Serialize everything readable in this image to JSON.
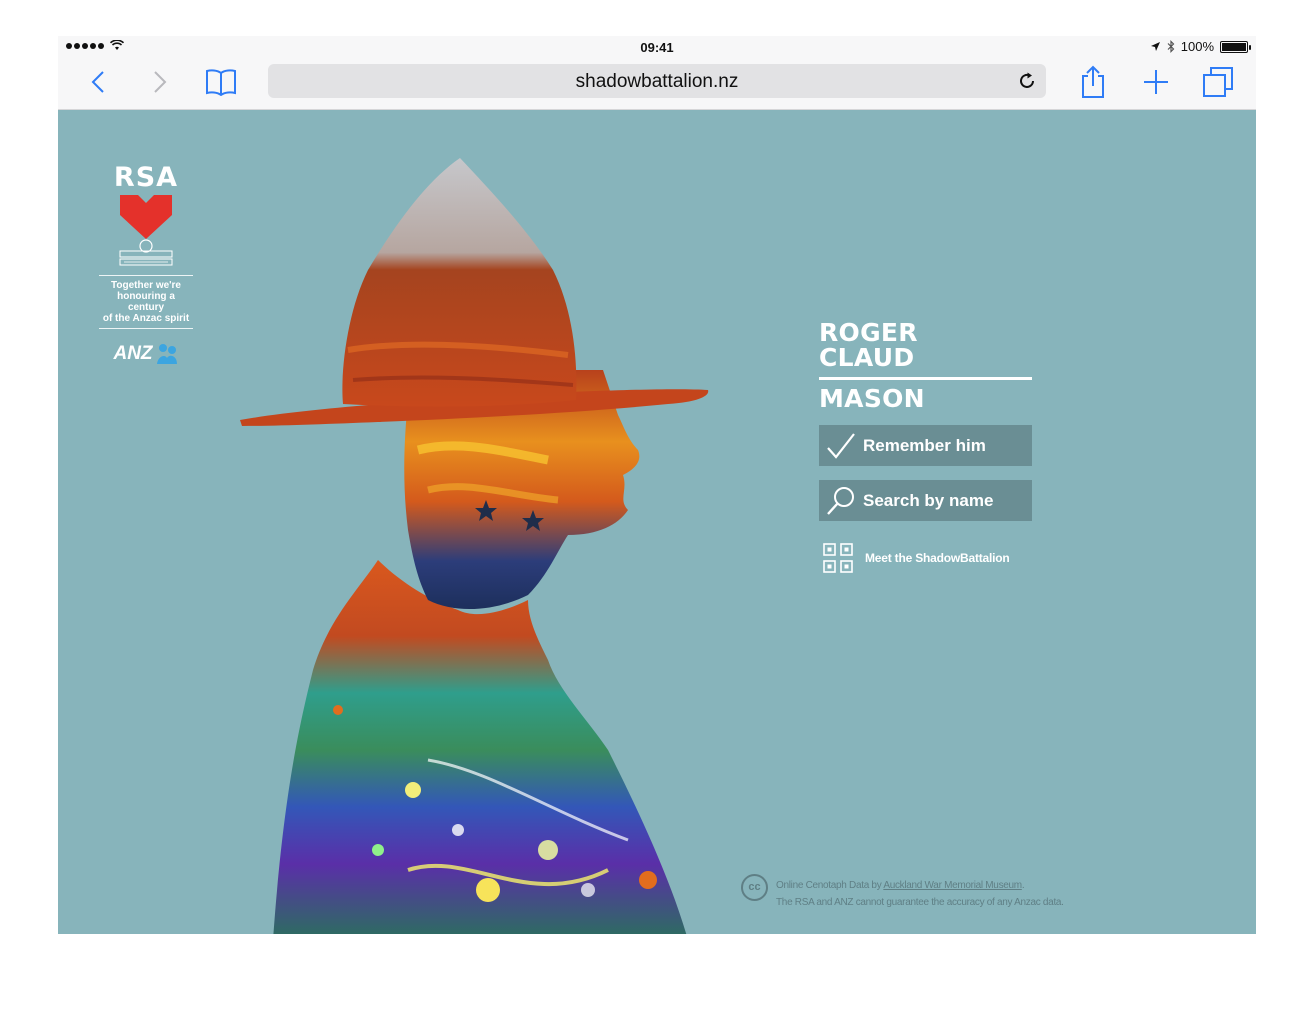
{
  "status_bar": {
    "time": "09:41",
    "battery": "100%",
    "battery_level": 1.0
  },
  "browser": {
    "url": "shadowbattalion.nz",
    "icons": {
      "back": "chevron-left-icon",
      "forward": "chevron-right-icon",
      "bookmarks": "book-icon",
      "reload": "reload-icon",
      "share": "share-icon",
      "new_tab": "plus-icon",
      "tabs": "tabs-icon"
    }
  },
  "brand": {
    "rsa_logo_text": "RSA",
    "tagline": [
      "Together we're",
      "honouring a century",
      "of the Anzac spirit"
    ],
    "anz_logo_text": "ANZ"
  },
  "soldier": {
    "first_names": [
      "ROGER",
      "CLAUD"
    ],
    "surname": "MASON"
  },
  "actions": {
    "remember": "Remember him",
    "search": "Search by name",
    "meet": "Meet the ShadowBattalion"
  },
  "credits": {
    "cc_label": "cc",
    "line1_prefix": "Online Cenotaph Data by ",
    "line1_link": "Auckland War Memorial Museum",
    "line1_suffix": ".",
    "line2": "The RSA and ANZ cannot guarantee the accuracy of any Anzac data."
  },
  "colors": {
    "page_background": "#87b4bb",
    "button_background": "#6a8e94",
    "heart_red": "#e4312b",
    "browser_chrome": "#f7f7f8",
    "ios_blue": "#2f7cf6"
  }
}
